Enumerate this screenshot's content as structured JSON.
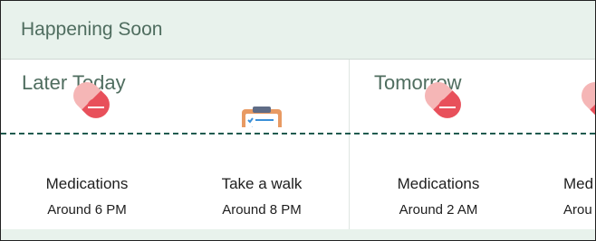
{
  "header": {
    "title": "Happening Soon"
  },
  "sections": [
    {
      "title": "Later Today",
      "events": [
        {
          "name": "Medications",
          "time": "Around 6 PM",
          "icon": "pill-icon"
        },
        {
          "name": "Take a walk",
          "time": "Around 8 PM",
          "icon": "clipboard-checklist-icon"
        }
      ]
    },
    {
      "title": "Tomorrow",
      "events": [
        {
          "name": "Medications",
          "time": "Around 2 AM",
          "icon": "pill-icon"
        },
        {
          "name": "Med",
          "time": "Arou",
          "icon": "pill-icon"
        }
      ]
    }
  ],
  "colors": {
    "header_bg": "#e8f2ec",
    "header_text": "#4f6d5f",
    "timeline": "#1f5b4f",
    "pill_light": "#f5b6b6",
    "pill_dark": "#e8505b",
    "clipboard_orange": "#e89a63",
    "check_blue": "#3a8fd8"
  }
}
